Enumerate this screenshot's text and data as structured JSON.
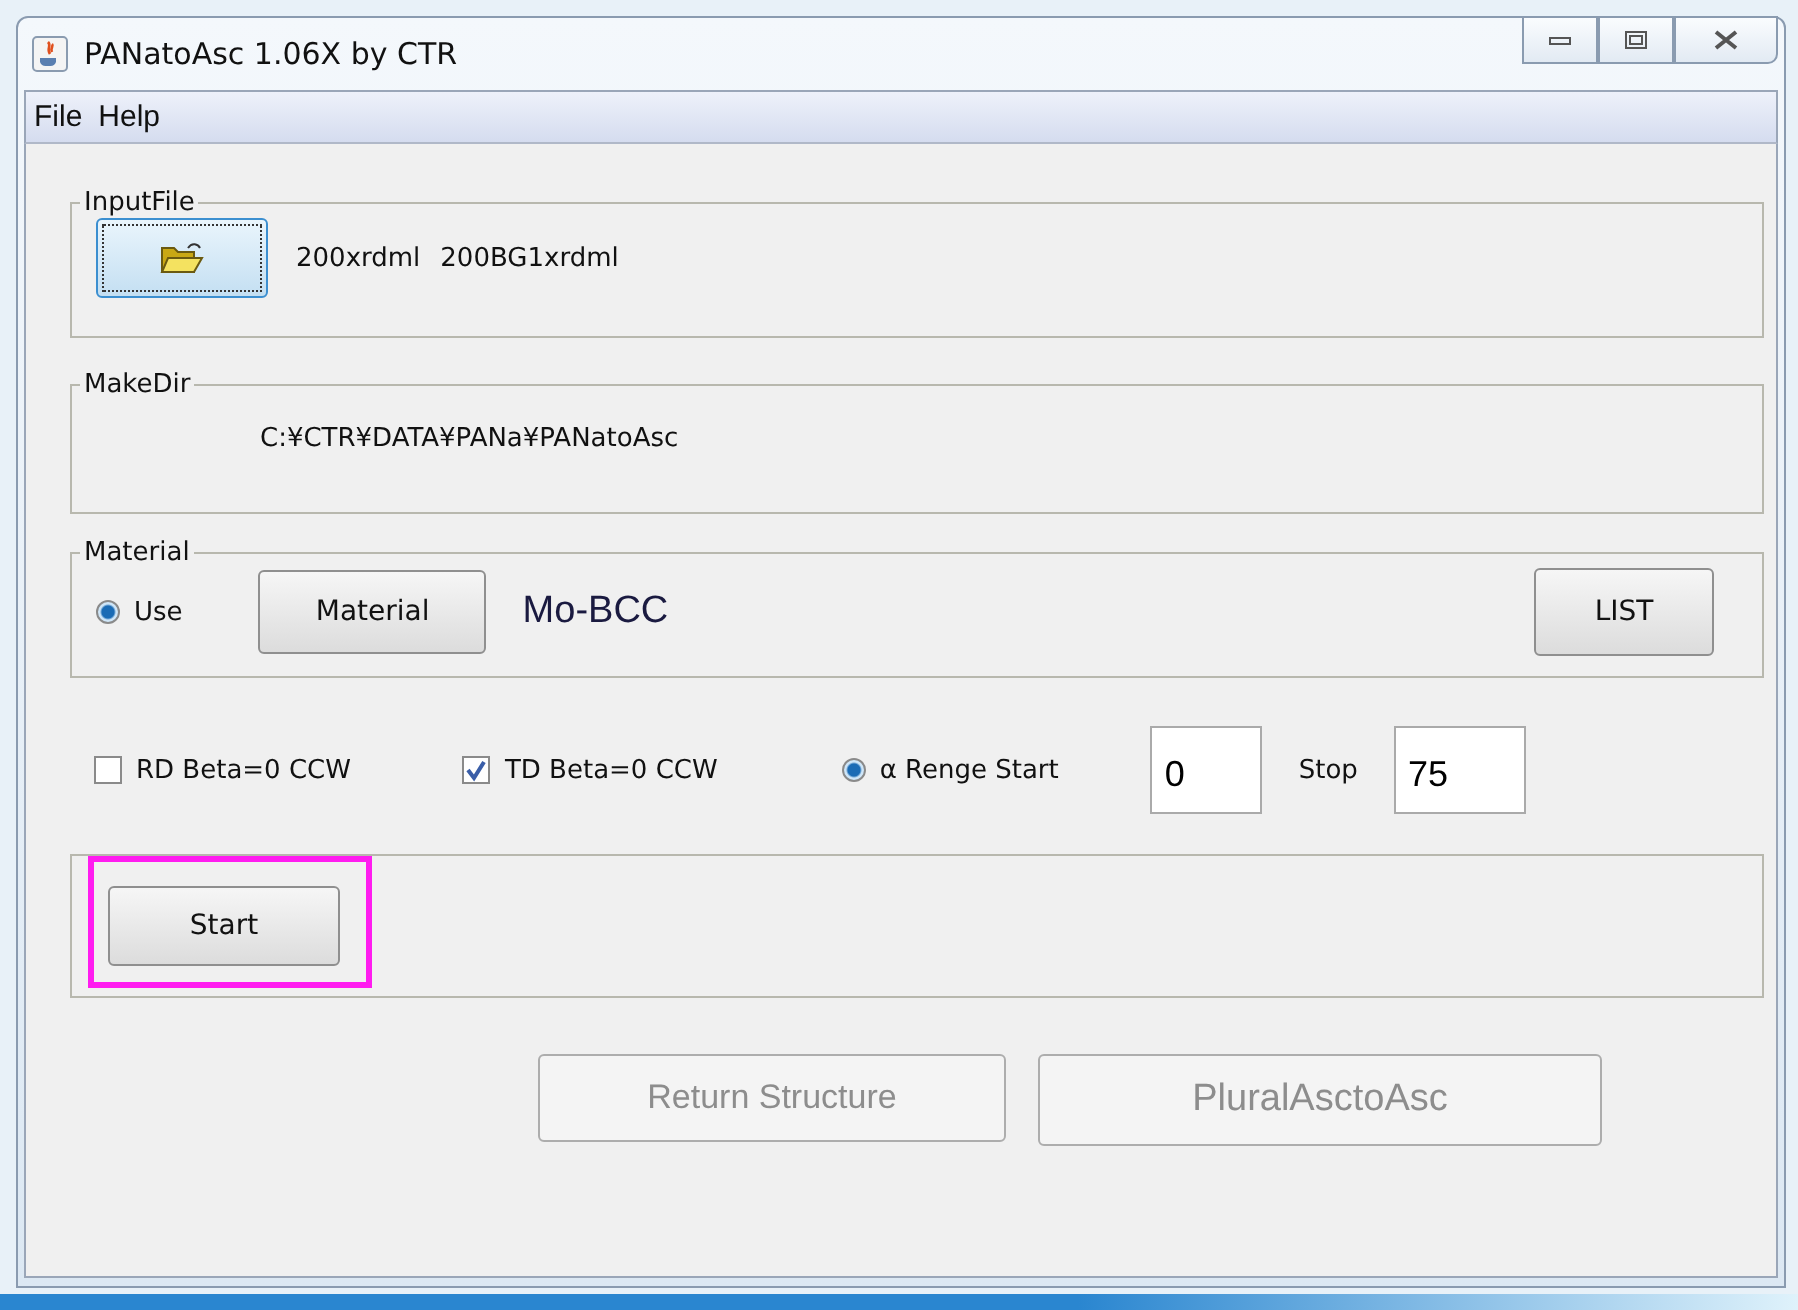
{
  "window": {
    "title": "PANatoAsc 1.06X by CTR"
  },
  "menu": [
    {
      "label": "File"
    },
    {
      "label": "Help"
    }
  ],
  "input_file": {
    "legend": "InputFile",
    "files": [
      "200xrdml",
      "200BG1xrdml"
    ]
  },
  "make_dir": {
    "legend": "MakeDir",
    "path": "C:¥CTR¥DATA¥PANa¥PANatoAsc"
  },
  "material": {
    "legend": "Material",
    "use_label": "Use",
    "use_selected": true,
    "button": "Material",
    "value": "Mo-BCC",
    "list_button": "LIST"
  },
  "options": [
    {
      "kind": "checkbox",
      "label": "RD Beta=0 CCW",
      "checked": false
    },
    {
      "kind": "checkbox",
      "label": "TD Beta=0 CCW",
      "checked": true
    },
    {
      "kind": "radio",
      "label": "α Renge Start",
      "selected": true
    },
    {
      "kind": "field",
      "value": "0"
    },
    {
      "kind": "label",
      "label": "Stop"
    },
    {
      "kind": "field",
      "value": "75"
    }
  ],
  "start_button": {
    "label": "Start",
    "highlighted": true
  },
  "bottom_buttons": [
    {
      "label": "Return Structure",
      "disabled": true
    },
    {
      "label": "PluralAsctoAsc",
      "disabled": true
    }
  ]
}
